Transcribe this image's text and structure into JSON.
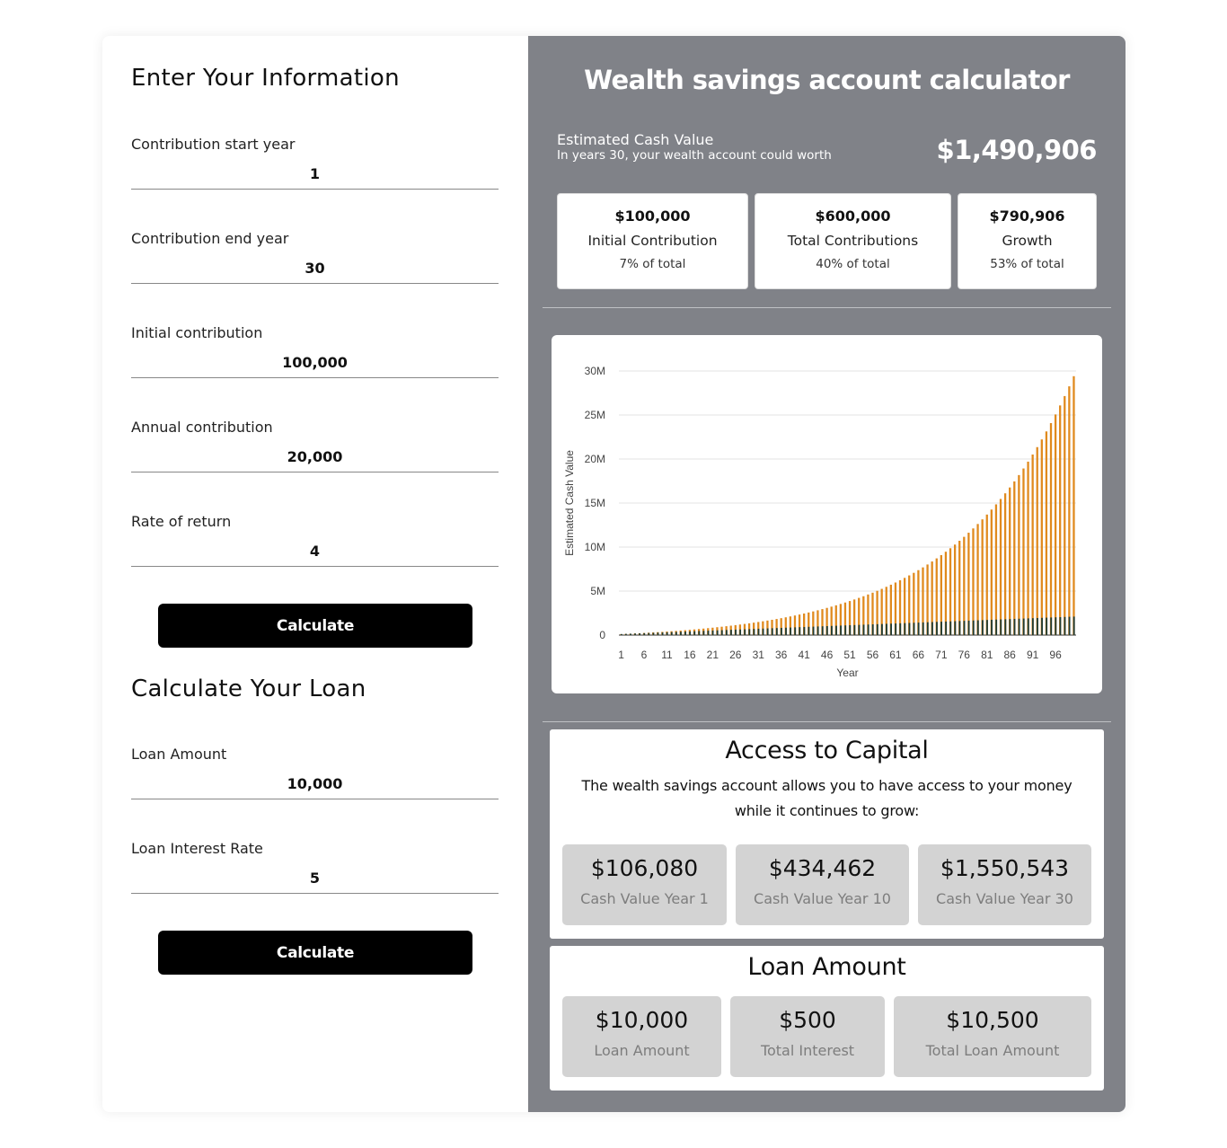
{
  "left": {
    "info_heading": "Enter Your Information",
    "fields": [
      {
        "label": "Contribution start year",
        "value": "1"
      },
      {
        "label": "Contribution end year",
        "value": "30"
      },
      {
        "label": "Initial contribution",
        "value": "100,000"
      },
      {
        "label": "Annual contribution",
        "value": "20,000"
      },
      {
        "label": "Rate of return",
        "value": "4"
      }
    ],
    "calculate_label": "Calculate",
    "loan_heading": "Calculate Your Loan",
    "loan_fields": [
      {
        "label": "Loan Amount",
        "value": "10,000"
      },
      {
        "label": "Loan Interest Rate",
        "value": "5"
      }
    ],
    "loan_calculate_label": "Calculate"
  },
  "right": {
    "title": "Wealth savings account calculator",
    "estimated_label": "Estimated Cash Value",
    "estimated_sub": "In years 30, your wealth account could worth",
    "estimated_value": "$1,490,906",
    "stats": [
      {
        "value": "$100,000",
        "name": "Initial Contribution",
        "pct": "7% of total"
      },
      {
        "value": "$600,000",
        "name": "Total Contributions",
        "pct": "40% of total"
      },
      {
        "value": "$790,906",
        "name": "Growth",
        "pct": "53% of total"
      }
    ],
    "capital": {
      "title": "Access to Capital",
      "description": "The wealth savings account allows you to have access to your money while it continues to grow:",
      "tiles": [
        {
          "value": "$106,080",
          "label": "Cash Value Year 1"
        },
        {
          "value": "$434,462",
          "label": "Cash Value Year 10"
        },
        {
          "value": "$1,550,543",
          "label": "Cash Value Year 30"
        }
      ]
    },
    "loan": {
      "title": "Loan Amount",
      "tiles": [
        {
          "value": "$10,000",
          "label": "Loan Amount"
        },
        {
          "value": "$500",
          "label": "Total Interest"
        },
        {
          "value": "$10,500",
          "label": "Total Loan Amount"
        }
      ]
    }
  },
  "chart_data": {
    "type": "bar",
    "xlabel": "Year",
    "ylabel": "Estimated Cash Value",
    "ylim": [
      0,
      30000000
    ],
    "y_ticks": [
      "0",
      "5M",
      "10M",
      "15M",
      "20M",
      "25M",
      "30M"
    ],
    "x_ticks": [
      "1",
      "6",
      "11",
      "16",
      "21",
      "26",
      "31",
      "36",
      "41",
      "46",
      "51",
      "56",
      "61",
      "66",
      "71",
      "76",
      "81",
      "86",
      "91",
      "96"
    ],
    "year_count": 100,
    "series": [
      {
        "color": "#e08a1e",
        "values": [
          106080,
          130723,
          156352,
          183006,
          210726,
          239555,
          269537,
          300719,
          333148,
          366874,
          401949,
          438427,
          476364,
          515819,
          556851,
          599525,
          643906,
          690062,
          738064,
          787987,
          839907,
          893903,
          950060,
          1008462,
          1069200,
          1132368,
          1198063,
          1266385,
          1337441,
          1411339,
          1488192,
          1568120,
          1651245,
          1737695,
          1827603,
          1921107,
          2018351,
          2119485,
          2224664,
          2334050,
          2447812,
          2566124,
          2689169,
          2817136,
          2950221,
          3088630,
          3232575,
          3382278,
          3537969,
          3699888,
          3868283,
          4043415,
          4225552,
          4414974,
          4611973,
          4816852,
          5029926,
          5251523,
          5481984,
          5721663,
          5970930,
          6230167,
          6499774,
          6780165,
          7071771,
          7375042,
          7690444,
          8018462,
          8359600,
          8714384,
          9083359,
          9467093,
          9866177,
          10281224,
          10712873,
          11161788,
          11628660,
          12114206,
          12619174,
          13144341,
          13690515,
          14258536,
          14849278,
          15463649,
          16102595,
          16767099,
          17458183,
          18176910,
          18924386,
          19701762,
          20510233,
          21351043,
          22225484,
          23134906,
          24080703,
          25064331,
          26087304,
          27151196,
          28257645,
          29408351
        ]
      },
      {
        "color": "#1f3b34",
        "values": [
          120000,
          140000,
          160000,
          180000,
          200000,
          220000,
          240000,
          260000,
          280000,
          300000,
          320000,
          340000,
          360000,
          380000,
          400000,
          420000,
          440000,
          460000,
          480000,
          500000,
          520000,
          540000,
          560000,
          580000,
          600000,
          620000,
          640000,
          660000,
          680000,
          700000,
          720000,
          740000,
          760000,
          780000,
          800000,
          820000,
          840000,
          860000,
          880000,
          900000,
          920000,
          940000,
          960000,
          980000,
          1000000,
          1020000,
          1040000,
          1060000,
          1080000,
          1100000,
          1120000,
          1140000,
          1160000,
          1180000,
          1200000,
          1220000,
          1240000,
          1260000,
          1280000,
          1300000,
          1320000,
          1340000,
          1360000,
          1380000,
          1400000,
          1420000,
          1440000,
          1460000,
          1480000,
          1500000,
          1520000,
          1540000,
          1560000,
          1580000,
          1600000,
          1620000,
          1640000,
          1660000,
          1680000,
          1700000,
          1720000,
          1740000,
          1760000,
          1780000,
          1800000,
          1820000,
          1840000,
          1860000,
          1880000,
          1900000,
          1920000,
          1940000,
          1960000,
          1980000,
          2000000,
          2020000,
          2040000,
          2060000,
          2080000,
          2100000
        ]
      }
    ]
  }
}
